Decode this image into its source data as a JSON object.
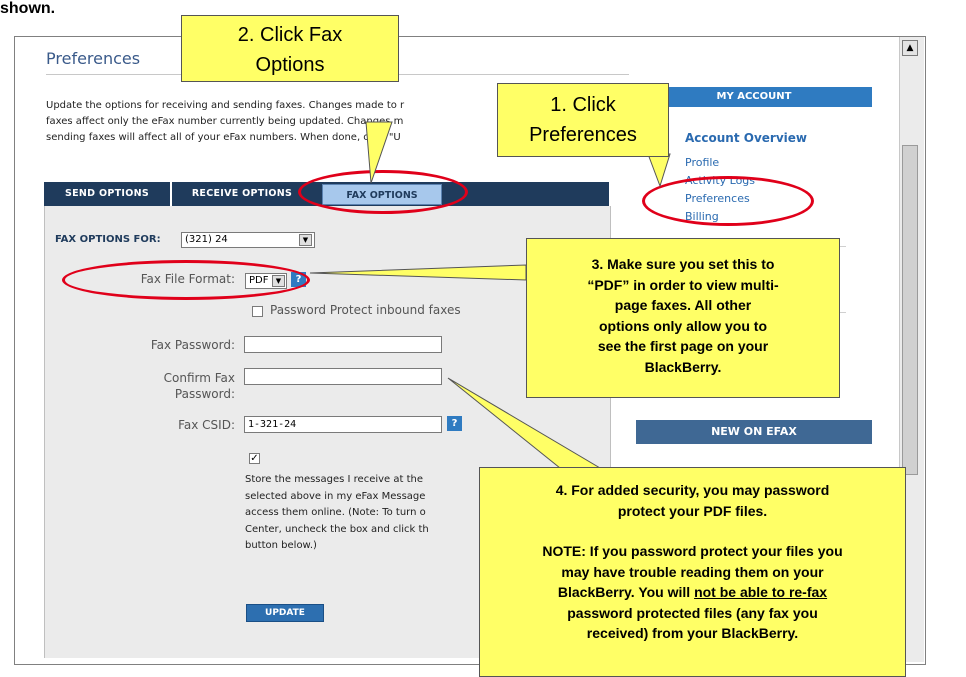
{
  "top_text": "shown.",
  "page": {
    "title": "Preferences",
    "intro_lines": [
      "Update the options for receiving and sending faxes. Changes made to r",
      "faxes affect only the eFax number currently being updated. Changes m",
      "sending faxes will affect all of your eFax numbers. When done, click \"U"
    ]
  },
  "tabs": {
    "send": "SEND OPTIONS",
    "receive": "RECEIVE OPTIONS",
    "fax": "FAX OPTIONS"
  },
  "form": {
    "fax_options_for_label": "FAX OPTIONS FOR:",
    "fax_options_for_value": "(321) 24",
    "file_format_label": "Fax File Format:",
    "file_format_value": "PDF",
    "password_protect_label": "Password Protect inbound faxes",
    "password_label": "Fax Password:",
    "confirm_label_1": "Confirm Fax",
    "confirm_label_2": "Password:",
    "csid_label": "Fax CSID:",
    "csid_value": "1-321-24",
    "help_glyph": "?",
    "check_glyph": "✓",
    "store_lines": [
      "Store the messages I receive at the",
      "selected above in my eFax Message",
      "access them online. (Note: To turn o",
      "Center, uncheck the box and click th",
      "button below.)"
    ],
    "update_button": "UPDATE"
  },
  "sidebar": {
    "header": "MY ACCOUNT",
    "title": "Account Overview",
    "links": [
      "Profile",
      "Activity Logs",
      "Preferences",
      "Billing"
    ],
    "partial_char": "r",
    "header2": "NEW ON EFAX"
  },
  "callouts": {
    "c1_lines": [
      "1. Click",
      "Preferences"
    ],
    "c2_lines": [
      "2. Click Fax",
      "Options"
    ],
    "c3_lines": [
      "3. Make sure you set this to",
      "“PDF” in order to view multi-",
      "page faxes.  All other",
      "options only allow you to",
      "see the first page on your",
      "BlackBerry."
    ],
    "c4_lines": [
      "4. For added security, you may password",
      "protect your PDF files."
    ],
    "c4_note_lines": [
      "NOTE: If you password protect your files you",
      "may have trouble reading them on your",
      "BlackBerry.  You will",
      "not be able to re-fax",
      "password protected files (any fax you",
      "received) from your BlackBerry."
    ]
  },
  "scrollbar": {
    "up_glyph": "▲"
  },
  "colors": {
    "callout_yellow": "#ffff66",
    "highlight_red": "#e0001a",
    "tab_navy": "#1f3b5c",
    "link_blue": "#2a6ab0"
  }
}
